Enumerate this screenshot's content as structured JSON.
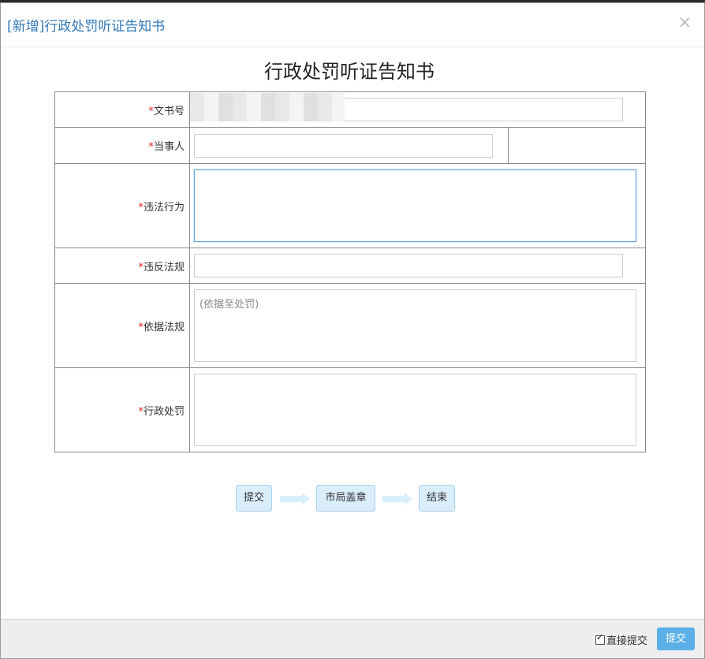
{
  "modal": {
    "title": "[新增]行政处罚听证告知书",
    "close_glyph": "×"
  },
  "document": {
    "title": "行政处罚听证告知书"
  },
  "form": {
    "required_mark": "*",
    "fields": [
      {
        "label": "文书号",
        "value": ""
      },
      {
        "label": "当事人",
        "value": ""
      },
      {
        "label": "违法行为",
        "value": ""
      },
      {
        "label": "违反法规",
        "value": ""
      },
      {
        "label": "依据法规",
        "value": "",
        "placeholder": "(依据至处罚)"
      },
      {
        "label": "行政处罚",
        "value": ""
      }
    ]
  },
  "workflow": {
    "steps": [
      "提交",
      "市局盖章",
      "结束"
    ]
  },
  "footer": {
    "checkbox_label": "直接提交",
    "checkbox_checked": true,
    "submit_label": "提交"
  },
  "colors": {
    "accent": "#5bb0e8",
    "title_blue": "#337ab7",
    "required_red": "#e02020",
    "step_bg": "#daeefa"
  }
}
